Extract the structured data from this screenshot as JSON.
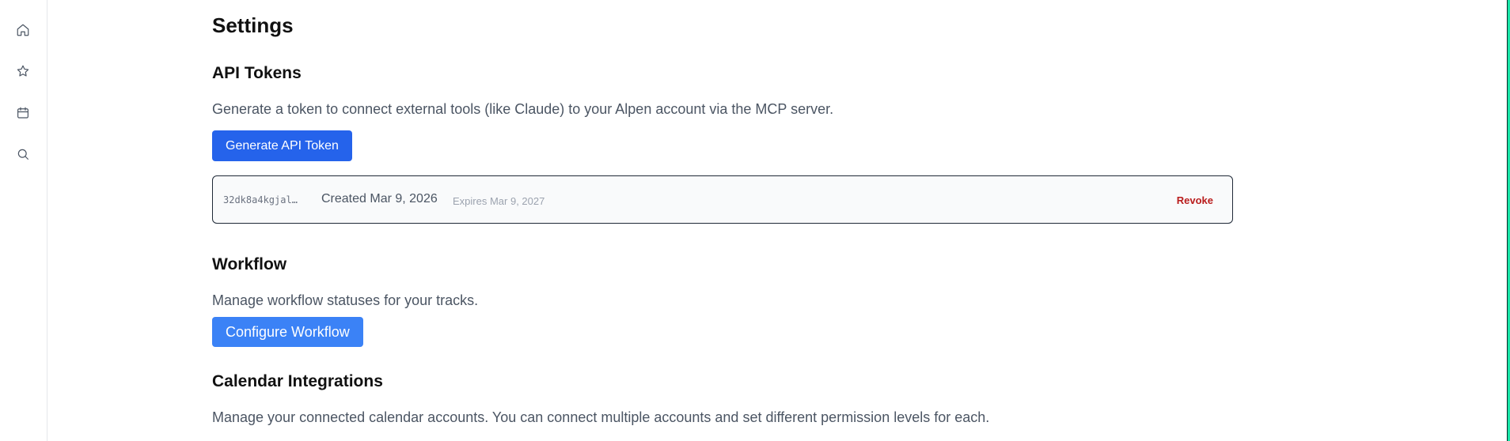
{
  "sidebar": {
    "items": [
      {
        "icon": "home-icon",
        "name": "sidebar-item-home"
      },
      {
        "icon": "star-icon",
        "name": "sidebar-item-favorites"
      },
      {
        "icon": "calendar-icon",
        "name": "sidebar-item-calendar"
      },
      {
        "icon": "search-icon",
        "name": "sidebar-item-search"
      }
    ],
    "icon_color": "#4b5563"
  },
  "page": {
    "title": "Settings"
  },
  "api_tokens": {
    "heading": "API Tokens",
    "description": "Generate a token to connect external tools (like Claude) to your Alpen account via the MCP server.",
    "generate_button_label": "Generate API Token",
    "tokens": [
      {
        "id": "32dk8a4kgjal…",
        "created": "Created Mar 9, 2026",
        "expires": "Expires Mar 9, 2027",
        "revoke_label": "Revoke"
      }
    ]
  },
  "workflow": {
    "heading": "Workflow",
    "description": "Manage workflow statuses for your tracks.",
    "configure_button_label": "Configure Workflow"
  },
  "calendar_integrations": {
    "heading": "Calendar Integrations",
    "description": "Manage your connected calendar accounts. You can connect multiple accounts and set different permission levels for each."
  },
  "colors": {
    "primary_button": "#2563eb",
    "secondary_button": "#3b82f6",
    "danger": "#b91c1c",
    "accent_edge": "#18e6a8"
  }
}
